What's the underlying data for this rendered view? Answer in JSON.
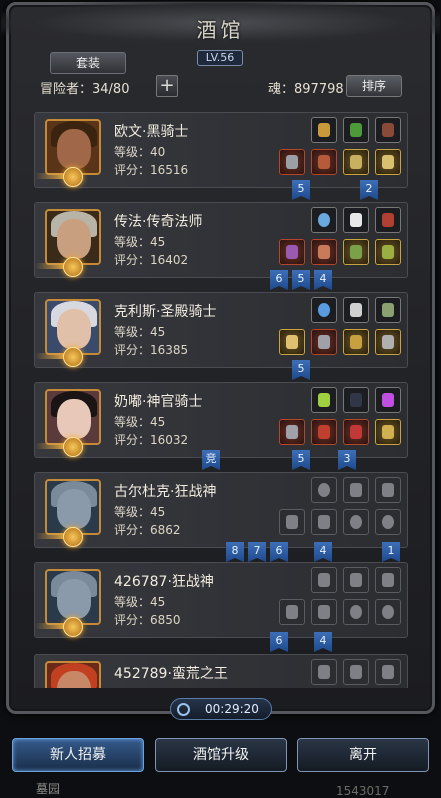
{
  "header": {
    "title": "酒馆",
    "level": "LV.56",
    "suit_label": "套装",
    "adventurers_label": "冒险者：34/80",
    "add_label": "+",
    "soul_label": "魂：897798",
    "sort_label": "排序"
  },
  "heroes": [
    {
      "name": "欧文·黑骑士",
      "level": "等级：40",
      "score": "评分：16516"
    },
    {
      "name": "传法·传奇法师",
      "level": "等级：45",
      "score": "评分：16402"
    },
    {
      "name": "克利斯·圣殿骑士",
      "level": "等级：45",
      "score": "评分：16385"
    },
    {
      "name": "奶嘟·神官骑士",
      "level": "等级：45",
      "score": "评分：16032"
    },
    {
      "name": "古尔杜克·狂战神",
      "level": "等级：45",
      "score": "评分：6862"
    },
    {
      "name": "426787·狂战神",
      "level": "等级：45",
      "score": "评分：6850"
    },
    {
      "name": "452789·蛮荒之王",
      "level": "",
      "score": ""
    }
  ],
  "ribbons": {
    "r1": [
      "5",
      "2"
    ],
    "r2": [
      "6",
      "5",
      "4"
    ],
    "r3": [
      "5"
    ],
    "r4": [
      "竞",
      "5",
      "3"
    ],
    "r5": [
      "8",
      "7",
      "6",
      "4",
      "1"
    ],
    "r6": [
      "6",
      "4"
    ]
  },
  "timer": {
    "value": "00:29:20",
    "icon": "clock-icon"
  },
  "buttons": {
    "recruit": "新人招募",
    "upgrade": "酒馆升级",
    "leave": "离开"
  },
  "footer": {
    "left": "墓园",
    "right": "1543017"
  },
  "colors": {
    "gold": "#c58a38",
    "ribbon_blue": "#2f5ea8",
    "accent_blue": "#6aa2e0"
  }
}
